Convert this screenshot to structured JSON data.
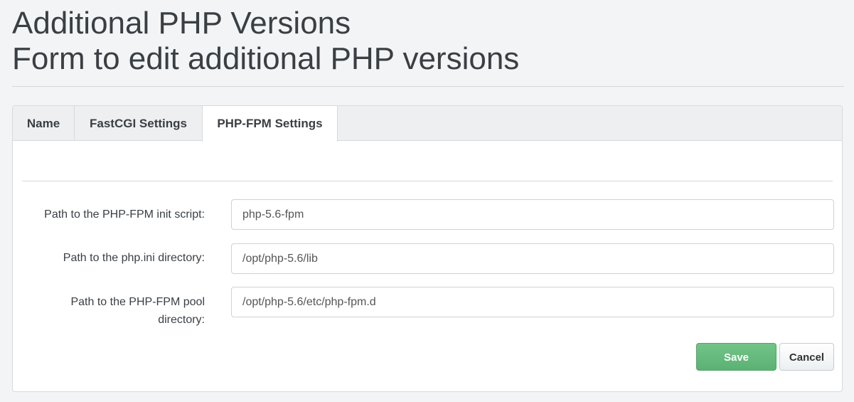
{
  "header": {
    "title": "Additional PHP Versions",
    "subtitle": "Form to edit additional PHP versions"
  },
  "tabs": [
    {
      "label": "Name",
      "active": false
    },
    {
      "label": "FastCGI Settings",
      "active": false
    },
    {
      "label": "PHP-FPM Settings",
      "active": true
    }
  ],
  "form": {
    "fields": [
      {
        "label": "Path to the PHP-FPM init script:",
        "value": "php-5.6-fpm"
      },
      {
        "label_line1": "Path to the php.ini directory:",
        "value": "/opt/php-5.6/lib"
      },
      {
        "label_line1": "Path to the PHP-FPM pool",
        "label_line2": "directory:",
        "value": "/opt/php-5.6/etc/php-fpm.d"
      }
    ],
    "save_label": "Save",
    "cancel_label": "Cancel"
  },
  "colors": {
    "save_button": "#5cb174",
    "background": "#f3f4f5"
  }
}
